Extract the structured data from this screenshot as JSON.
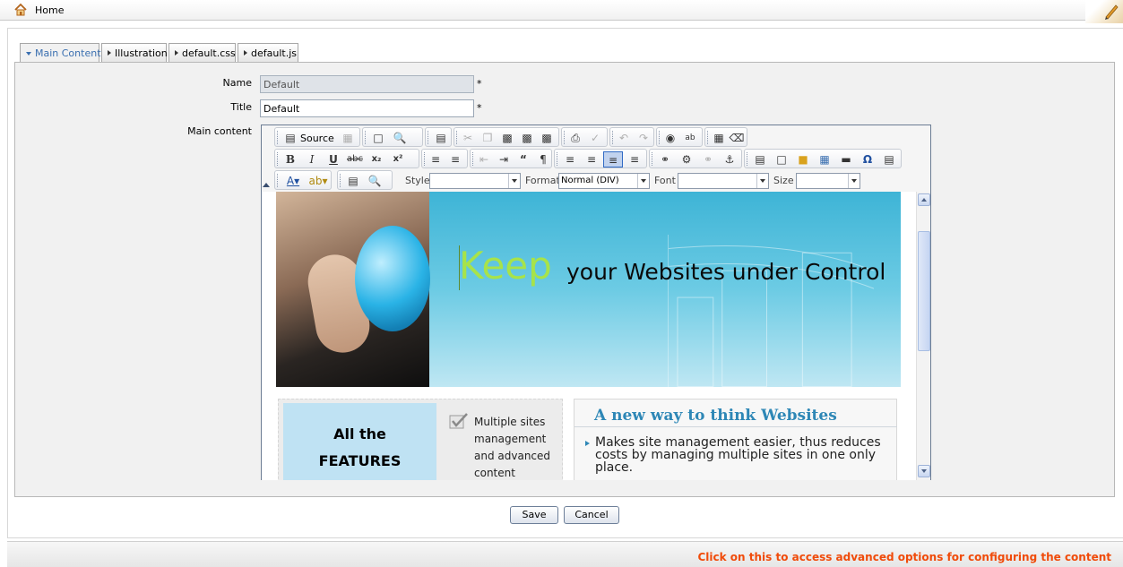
{
  "header": {
    "home_label": "Home"
  },
  "tabs": [
    {
      "label": "Main Content",
      "active": true
    },
    {
      "label": "Illustration",
      "active": false
    },
    {
      "label": "default.css",
      "active": false
    },
    {
      "label": "default.js",
      "active": false
    }
  ],
  "form": {
    "name_label": "Name",
    "name_value": "Default",
    "title_label": "Title",
    "title_value": "Default",
    "required_mark": "*",
    "content_label": "Main content"
  },
  "editor": {
    "toolbar": {
      "source_label": "Source",
      "style_label": "Style",
      "style_value": "",
      "format_label": "Format",
      "format_value": "Normal (DIV)",
      "font_label": "Font",
      "font_value": "",
      "size_label": "Size",
      "size_value": ""
    },
    "content": {
      "keep": "Keep",
      "headline_rest": "your Websites under Control",
      "features_line1": "All the",
      "features_line2": "FEATURES",
      "multi_sites": "Multiple sites management and advanced content",
      "new_way_title": "A new way to think Websites",
      "bullet_text": "Makes site management easier, thus reduces costs by managing multiple sites in one only place."
    }
  },
  "buttons": {
    "save": "Save",
    "cancel": "Cancel"
  },
  "footer": {
    "advanced_link": "Click on this to access advanced options for configuring the content"
  },
  "colors": {
    "accent": "#3a6fb0",
    "footer_link": "#f04b0a",
    "keep_green": "#a7e34a",
    "heading_blue": "#2e87b6"
  }
}
